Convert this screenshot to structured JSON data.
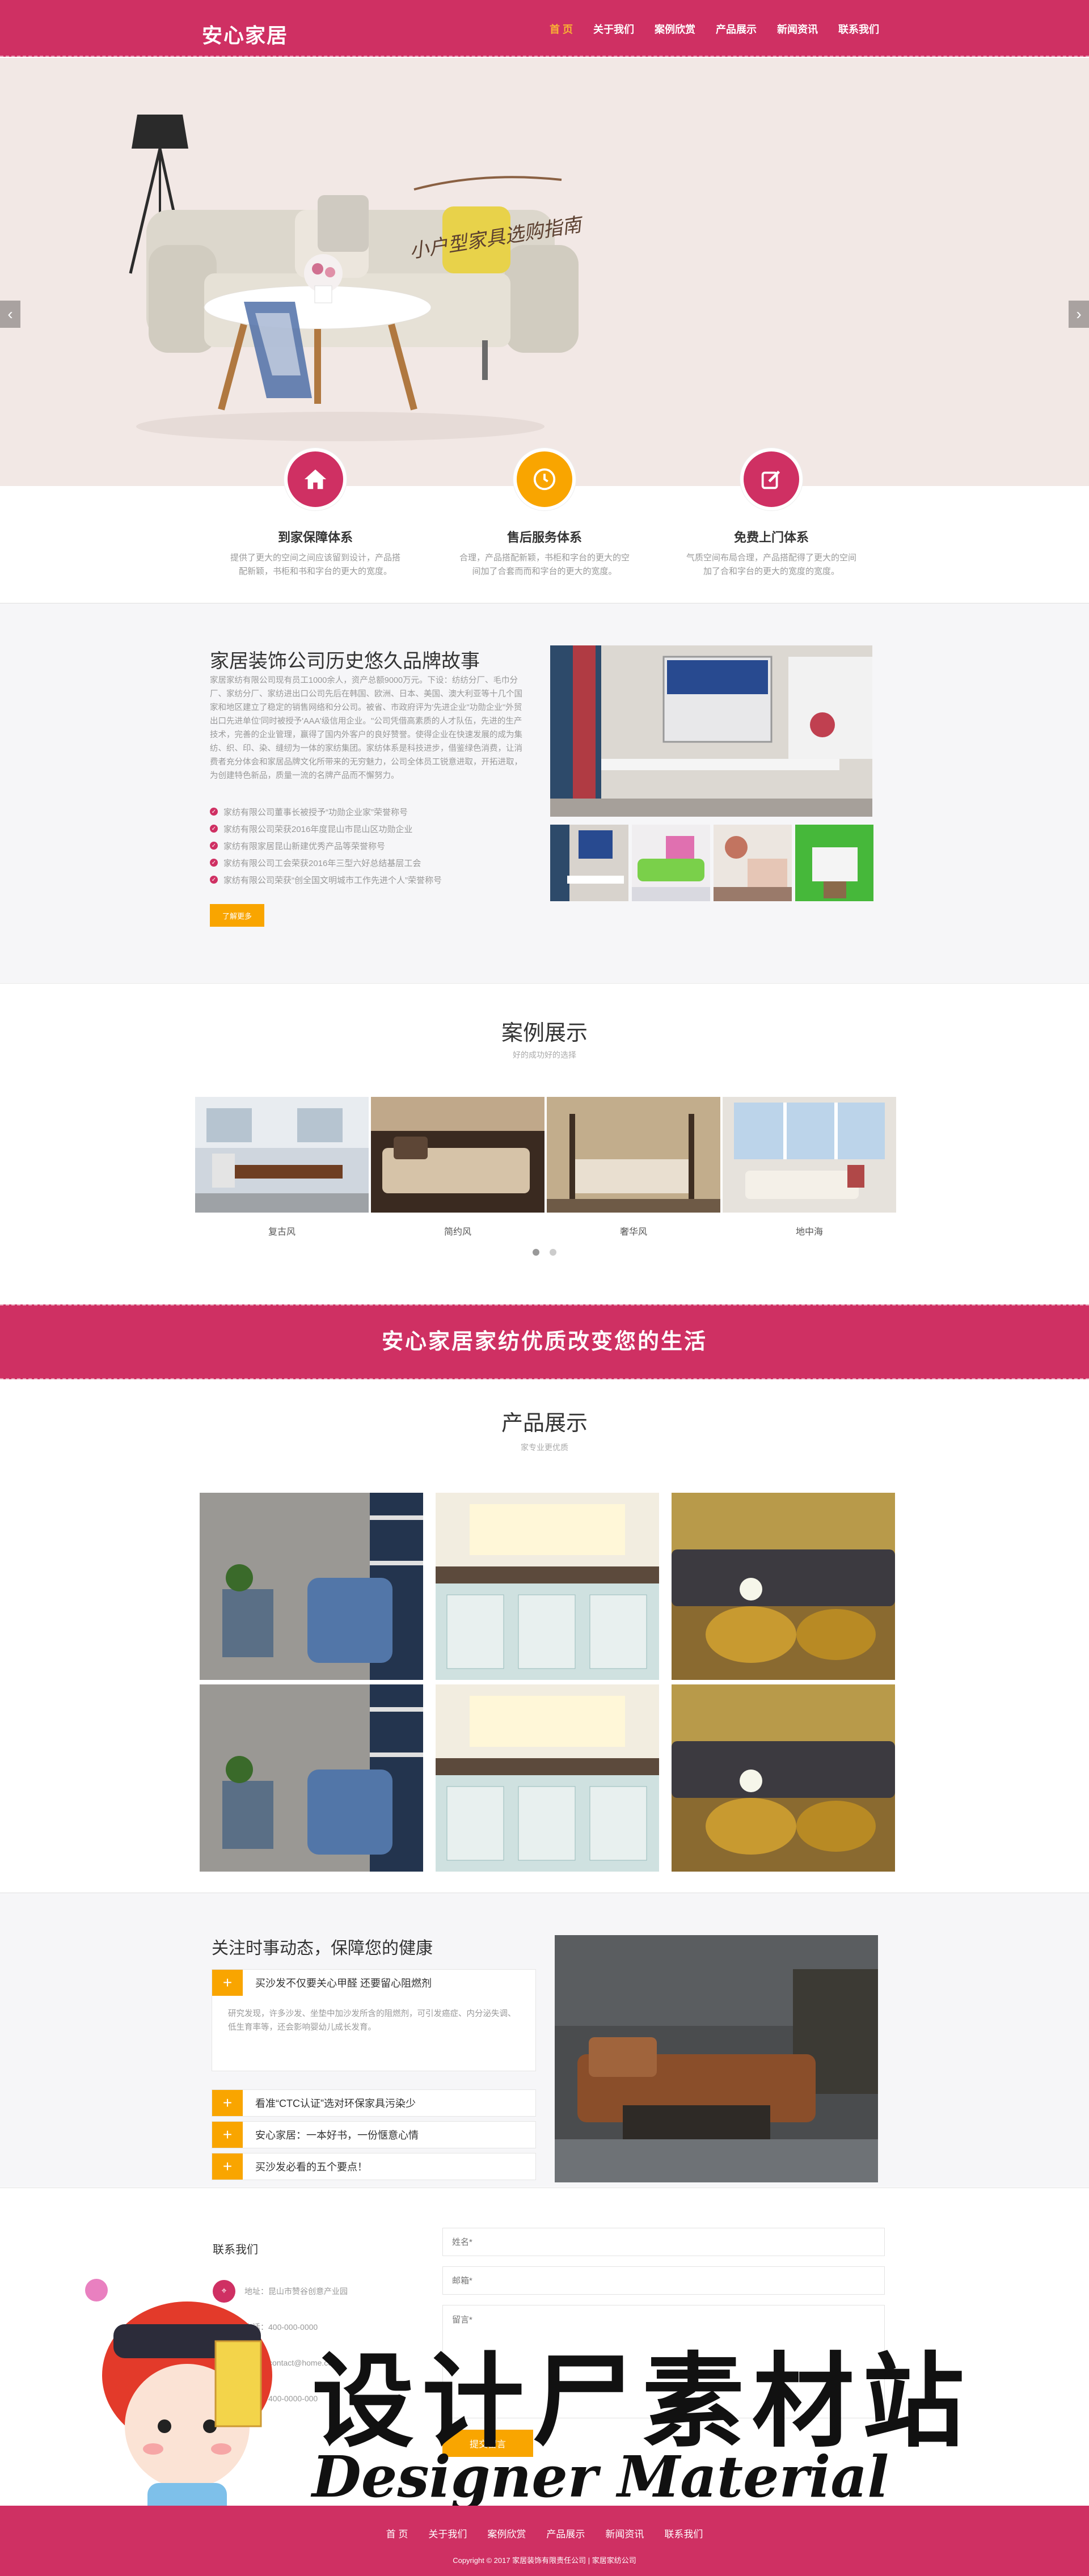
{
  "header": {
    "logo": "安心家居",
    "nav": [
      "首 页",
      "关于我们",
      "案例欣赏",
      "产品展示",
      "新闻资讯",
      "联系我们"
    ],
    "active_index": 0
  },
  "hero": {
    "caption": "小户型家具选购指南",
    "prev_icon": "chevron-left-icon",
    "next_icon": "chevron-right-icon"
  },
  "features": [
    {
      "icon": "home-icon",
      "color": "#cf3063",
      "title": "到家保障体系",
      "desc": "提供了更大的空间之间应该留到设计，产品搭配新颖，书柜和书和字台的更大的宽度。"
    },
    {
      "icon": "clock-icon",
      "color": "#f9a500",
      "title": "售后服务体系",
      "desc": "合理，产品搭配新颖，书柜和字台的更大的空间加了合套而而和字台的更大的宽度。"
    },
    {
      "icon": "edit-icon",
      "color": "#cf3063",
      "title": "免费上门体系",
      "desc": "气质空间布局合理，产品搭配得了更大的空间加了合和字台的更大的宽度的宽度。"
    }
  ],
  "about": {
    "title": "家居装饰公司历史悠久品牌故事",
    "text": "家居家纺有限公司现有员工1000余人，资产总额9000万元。下设：纺纺分厂、毛巾分厂、家纺分厂、家纺进出口公司先后在韩国、欧洲、日本、美国、澳大利亚等十几个国家和地区建立了稳定的销售网络和分公司。被省、市政府评为'先进企业''功勋企业''外贸出口先进单位'同时被授予'AAA'级信用企业。''公司凭借高素质的人才队伍，先进的生产技术，完善的企业管理，赢得了国内外客户的良好赞誉。使得企业在快速发展的成为集纺、织、印、染、缝纫为一体的家纺集团。家纺体系是科技进步，借鉴绿色消费，让消费者充分体会和家居品牌文化所带来的无穷魅力，公司全体员工锐意进取，开拓进取，为创建特色新品，质量一流的名牌产品而不懈努力。",
    "list": [
      "家纺有限公司董事长被授予“功勋企业家”荣誉称号",
      "家纺有限公司荣获2016年度昆山市昆山区功勋企业",
      "家纺有限家居昆山新建优秀产品等荣誉称号",
      "家纺有限公司工会荣获2016年三型六好总结基层工会",
      "家纺有限公司荣获“创全国文明城市工作先进个人”荣誉称号"
    ],
    "button": "了解更多"
  },
  "cases": {
    "title": "案例展示",
    "subtitle": "好的成功好的选择",
    "items": [
      "复古风",
      "简约风",
      "奢华风",
      "地中海"
    ],
    "dots": 2
  },
  "banner": {
    "text": "安心家居家纺优质改变您的生活"
  },
  "products": {
    "title": "产品展示",
    "subtitle": "家专业更优质"
  },
  "news": {
    "title": "关注时事动态，保障您的健康",
    "items": [
      {
        "title": "买沙发不仅要关心甲醛 还要留心阻燃剂",
        "body": "研究发现，许多沙发、坐垫中加沙发所含的阻燃剂，可引发癌症、内分泌失调、低生育率等，还会影响婴幼儿成长发育。"
      },
      {
        "title": "看准“CTC认证”选对环保家具污染少"
      },
      {
        "title": "安心家居：一本好书，一份惬意心情"
      },
      {
        "title": "买沙发必看的五个要点！"
      }
    ]
  },
  "contact": {
    "title": "联系我们",
    "info": [
      {
        "icon": "location-icon",
        "text": "地址：昆山市赞谷创意产业园"
      },
      {
        "icon": "phone-icon",
        "text": "电话：400-000-0000"
      },
      {
        "icon": "mail-icon",
        "text": "邮箱：contact@home.com"
      },
      {
        "icon": "fax-icon",
        "text": "传真：400-0000-000"
      }
    ],
    "name_placeholder": "姓名*",
    "email_placeholder": "邮箱*",
    "message_placeholder": "留言*",
    "submit": "提交留言"
  },
  "watermark": {
    "cn": "设计尸素材站",
    "en": "Designer Material Station"
  },
  "footer": {
    "nav": [
      "首 页",
      "关于我们",
      "案例欣赏",
      "产品展示",
      "新闻资讯",
      "联系我们"
    ],
    "copyright": "Copyright © 2017 家居装饰有限责任公司 | 家居家纺公司"
  },
  "colors": {
    "brand": "#cf3063",
    "accent": "#f9a500"
  }
}
